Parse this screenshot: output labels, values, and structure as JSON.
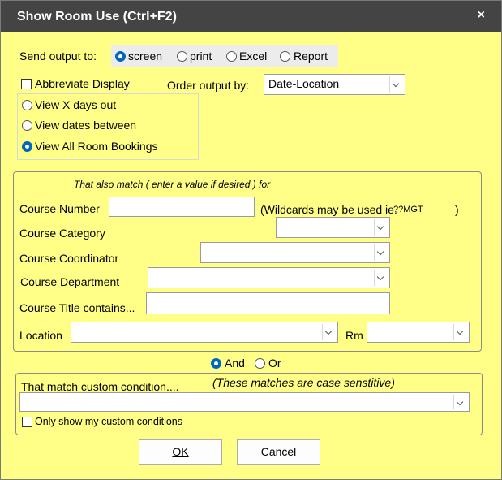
{
  "window": {
    "title": "Show Room Use  (Ctrl+F2)",
    "close_glyph": "×"
  },
  "output": {
    "label": "Send output to:",
    "options": [
      "screen",
      "print",
      "Excel",
      "Report"
    ],
    "selected": "screen"
  },
  "abbreviate": {
    "label": "Abbreviate Display",
    "checked": false
  },
  "order": {
    "label": "Order output by:",
    "value": "Date-Location"
  },
  "view_options": {
    "items": [
      "View X days out",
      "View dates between",
      "View All Room Bookings"
    ],
    "selected": "View All Room Bookings"
  },
  "match": {
    "heading": "That also match ( enter a value if desired ) for",
    "course_number": {
      "label": "Course Number",
      "value": "",
      "hint_prefix": "(Wildcards may be used ie.",
      "hint_example": "??MGT",
      "hint_suffix": ")"
    },
    "course_category": {
      "label": "Course Category",
      "value": ""
    },
    "course_coordinator": {
      "label": "Course Coordinator",
      "value": ""
    },
    "course_department": {
      "label": "Course Department",
      "value": ""
    },
    "course_title": {
      "label": "Course Title contains...",
      "value": ""
    },
    "location": {
      "label": "Location",
      "value": ""
    },
    "room": {
      "label": "Rm",
      "value": ""
    }
  },
  "logic": {
    "options": [
      "And",
      "Or"
    ],
    "selected": "And"
  },
  "custom": {
    "label": "That match custom condition....",
    "note": "(These matches are case senstitive)",
    "value": "",
    "only_label": "Only show my custom conditions",
    "only_checked": false
  },
  "buttons": {
    "ok": "OK",
    "cancel": "Cancel"
  },
  "colors": {
    "dialog_bg": "#ffff88",
    "titlebar": "#444444",
    "radio_selected": "#0067c0"
  }
}
